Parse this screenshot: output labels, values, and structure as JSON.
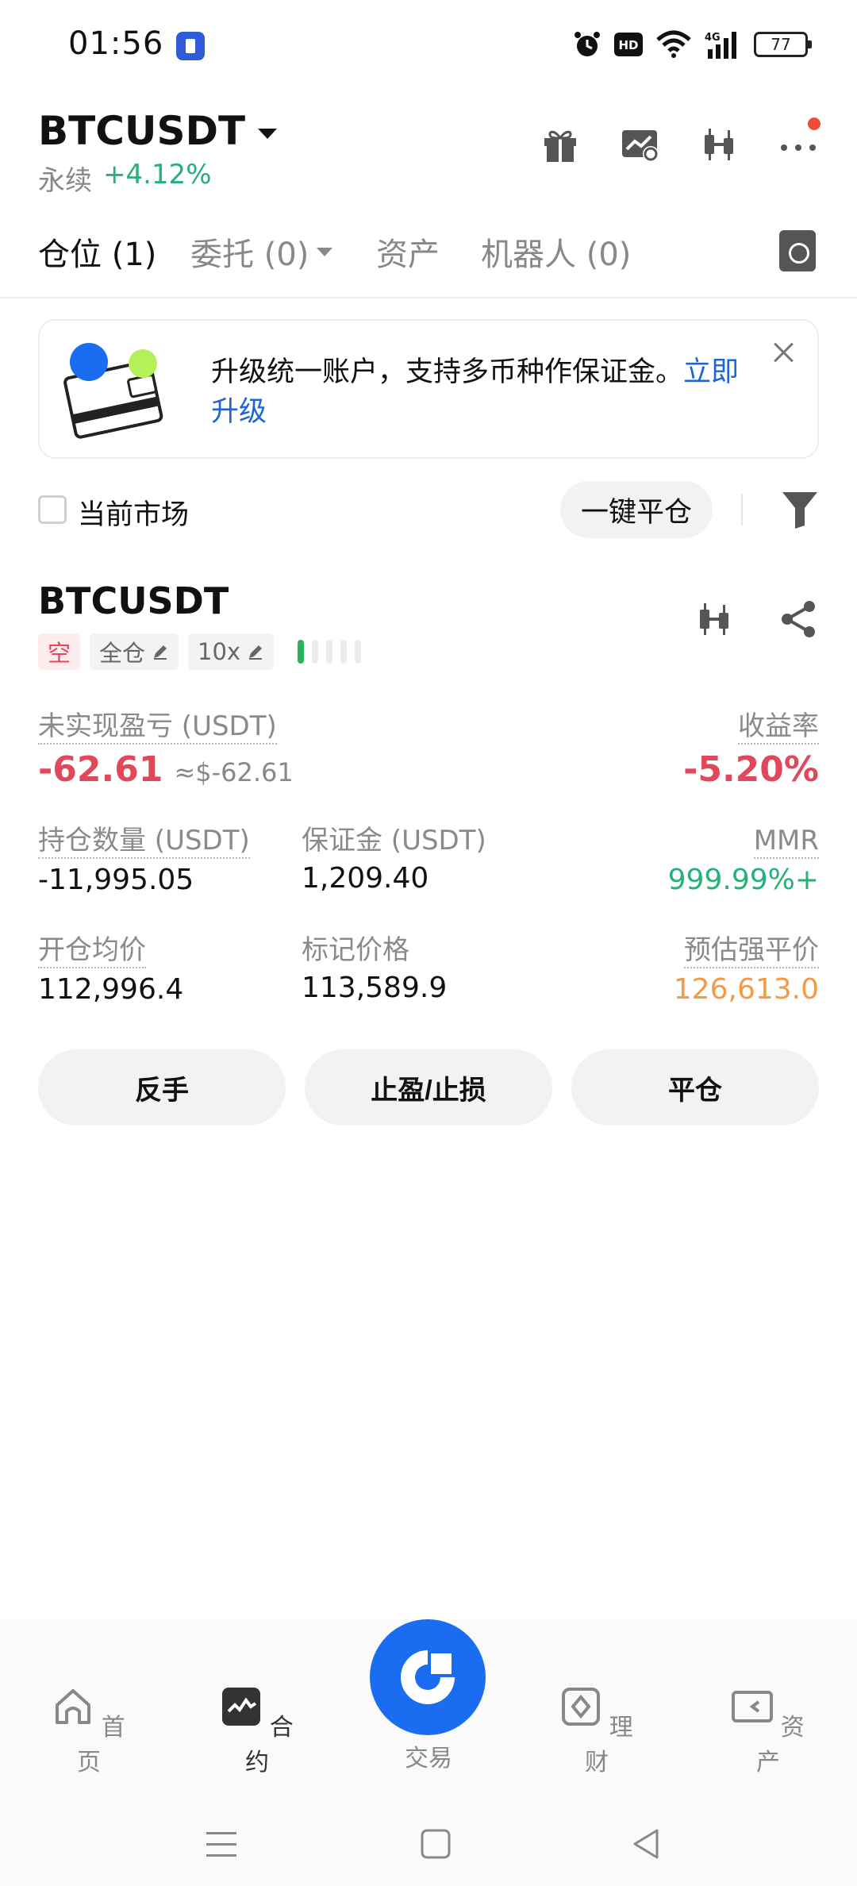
{
  "status_bar": {
    "time": "01:56",
    "network": "4G",
    "hd": "HD",
    "battery": "77",
    "icons": [
      "app-notification-icon",
      "alarm-icon",
      "hd-icon",
      "wifi-icon",
      "signal-icon",
      "battery-icon"
    ]
  },
  "header": {
    "pair": "BTCUSDT",
    "contract_type": "永续",
    "change": "+4.12%",
    "icons": [
      "gift-icon",
      "chart-settings-icon",
      "candlestick-icon",
      "more-icon"
    ]
  },
  "tabs": [
    {
      "label": "仓位 (1)"
    },
    {
      "label": "委托 (0)"
    },
    {
      "label": "资产"
    },
    {
      "label": "机器人 (0)"
    }
  ],
  "banner": {
    "text": "升级统一账户，支持多币种作保证金。",
    "link_a": "立即",
    "link_b": "升级"
  },
  "filter": {
    "current_market_label": "当前市场",
    "close_all_label": "一键平仓"
  },
  "position": {
    "symbol": "BTCUSDT",
    "side_tag": "空",
    "margin_mode": "全仓",
    "leverage": "10x",
    "risk_level": 1,
    "unrealized_pnl_label": "未实现盈亏 (USDT)",
    "unrealized_pnl": "-62.61",
    "unrealized_pnl_usd": "≈$-62.61",
    "roe_label": "收益率",
    "roe": "-5.20%",
    "size_label": "持仓数量 (USDT)",
    "size": "-11,995.05",
    "margin_label": "保证金 (USDT)",
    "margin": "1,209.40",
    "mmr_label": "MMR",
    "mmr": "999.99%+",
    "entry_label": "开仓均价",
    "entry_price": "112,996.4",
    "mark_label": "标记价格",
    "mark_price": "113,589.9",
    "liq_label": "预估强平价",
    "liq_price": "126,613.0"
  },
  "actions": {
    "reverse": "反手",
    "tpsl": "止盈/止损",
    "close": "平仓"
  },
  "bottom_nav": [
    {
      "label": "首页",
      "icon": "home-icon"
    },
    {
      "label": "合约",
      "icon": "futures-icon"
    },
    {
      "label": "交易",
      "icon": "trade-icon"
    },
    {
      "label": "理财",
      "icon": "earn-icon"
    },
    {
      "label": "资产",
      "icon": "wallet-icon"
    }
  ],
  "colors": {
    "accent": "#1a6cf0",
    "red": "#e2485c",
    "green": "#26b07a",
    "orange": "#f29a46"
  }
}
